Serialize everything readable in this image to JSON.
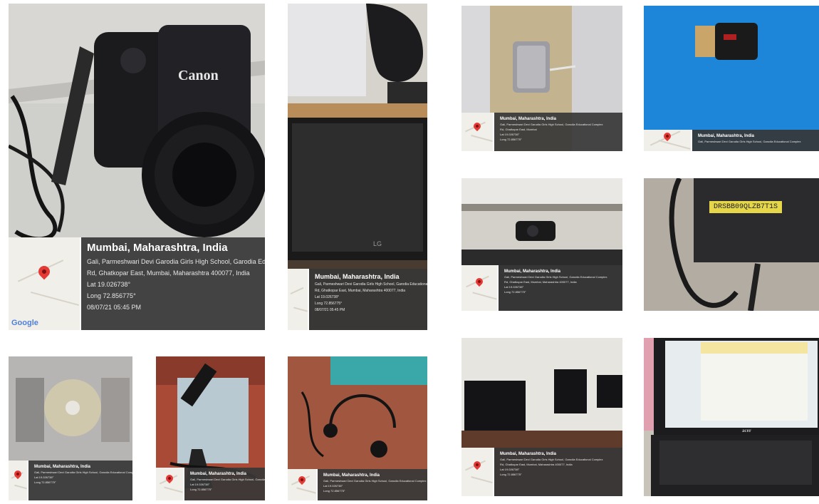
{
  "camera_photo": {
    "brand": "Canon",
    "geotag": {
      "location": "Mumbai, Maharashtra, India",
      "address_1": "Gali, Parmeshwari Devi Garodia Girls High School, Garodia Educational Complex",
      "address_2": "Rd, Ghatkopar East, Mumbai, Maharashtra 400077, India",
      "lat": "Lat 19.026738°",
      "long": "Long 72.856775°",
      "datetime": "08/07/21 05:45 PM",
      "map_logo": "Google"
    }
  },
  "monitor_photo": {
    "brand": "LG",
    "geotag": {
      "location": "Mumbai, Maharashtra, India",
      "address_1": "Gali, Parmeshwari Devi Garodia Girls High School, Garodia Educational Complex",
      "address_2": "Rd, Ghatkopar East, Mumbai, Maharashtra 400077, India",
      "lat": "Lat 19.026738°",
      "long": "Long 72.856775°",
      "datetime": "08/07/21 05:45 PM"
    }
  },
  "hdd_photo": {
    "geotag": {
      "location": "Mumbai, Maharashtra, India",
      "address_1": "Gali, Parmeshwari Devi Garodia Girls High School, Garodia Educational Complex",
      "address_2": "Rd, Ghatkopar East, Mumbai",
      "lat": "Lat 19.026738°",
      "long": "Long 72.856775°"
    }
  },
  "usb_photo": {
    "geotag": {
      "location": "Mumbai, Maharashtra, India",
      "address_1": "Gali, Parmeshwari Devi Garodia Girls High School, Garodia Educational Complex"
    }
  },
  "webcam_photo": {
    "geotag": {
      "location": "Mumbai, Maharashtra, India",
      "address_1": "Gali, Parmeshwari Devi Garodia Girls High School, Garodia Educational Complex",
      "address_2": "Rd, Ghatkopar East, Mumbai, Maharashtra 400077, India",
      "lat": "Lat 19.026738°",
      "long": "Long 72.856775°"
    }
  },
  "drive_label": {
    "text": "DRSBB09QLZB7T1S"
  },
  "cd_photo": {
    "geotag": {
      "location": "Mumbai, Maharashtra, India",
      "address_1": "Gali, Parmeshwari Devi Garodia Girls High School, Garodia Educational Complex",
      "lat": "Lat 19.026738°",
      "long": "Long 72.856775°"
    }
  },
  "mic_photo": {
    "geotag": {
      "location": "Mumbai, Maharashtra, India",
      "address_1": "Gali, Parmeshwari Devi Garodia Girls High School, Garodia Educational Complex",
      "lat": "Lat 19.026738°",
      "long": "Long 72.856775°"
    }
  },
  "headset_photo": {
    "geotag": {
      "location": "Mumbai, Maharashtra, India",
      "address_1": "Gali, Parmeshwari Devi Garodia Girls High School, Garodia Educational Complex",
      "lat": "Lat 19.026738°",
      "long": "Long 72.856775°"
    }
  },
  "desktops_photo": {
    "geotag": {
      "location": "Mumbai, Maharashtra, India",
      "address_1": "Gali, Parmeshwari Devi Garodia Girls High School, Garodia Educational Complex",
      "address_2": "Rd, Ghatkopar East, Mumbai, Maharashtra 400077, India",
      "lat": "Lat 19.026738°",
      "long": "Long 72.856775°"
    }
  },
  "laptop_photo": {
    "brand": "acer"
  }
}
